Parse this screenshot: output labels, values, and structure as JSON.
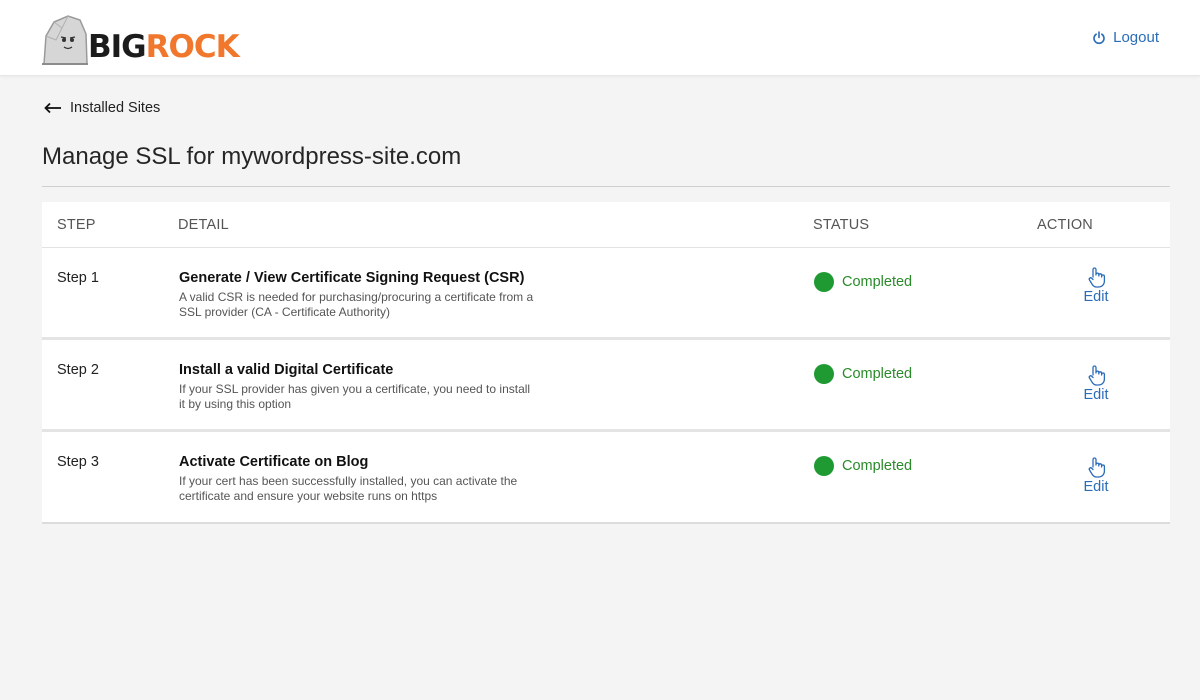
{
  "brand": {
    "name_part1": "BIG",
    "name_part2": "ROCK",
    "color_dark": "#1c1c1c",
    "color_accent": "#f0772b"
  },
  "header": {
    "logout_label": "Logout",
    "logout_icon": "power-icon"
  },
  "nav": {
    "back_label": "Installed Sites",
    "back_icon": "arrow-left-icon"
  },
  "page": {
    "title": "Manage SSL for mywordpress-site.com"
  },
  "table": {
    "headers": {
      "step": "STEP",
      "detail": "DETAIL",
      "status": "STATUS",
      "action": "ACTION"
    },
    "rows": [
      {
        "step": "Step 1",
        "title": "Generate / View Certificate Signing Request (CSR)",
        "description": "A valid CSR is needed for purchasing/procuring a certificate from a SSL provider (CA - Certificate Authority)",
        "status": "Completed",
        "action": "Edit"
      },
      {
        "step": "Step 2",
        "title": "Install a valid Digital Certificate",
        "description": "If your SSL provider has given you a certificate, you need to install it by using this option",
        "status": "Completed",
        "action": "Edit"
      },
      {
        "step": "Step 3",
        "title": "Activate Certificate on Blog",
        "description": "If your cert has been successfully installed, you can activate the certificate and ensure your website runs on https",
        "status": "Completed",
        "action": "Edit"
      }
    ]
  },
  "colors": {
    "link_blue": "#2b6cb8",
    "status_green": "#1f9a33",
    "background": "#f4f4f4"
  }
}
